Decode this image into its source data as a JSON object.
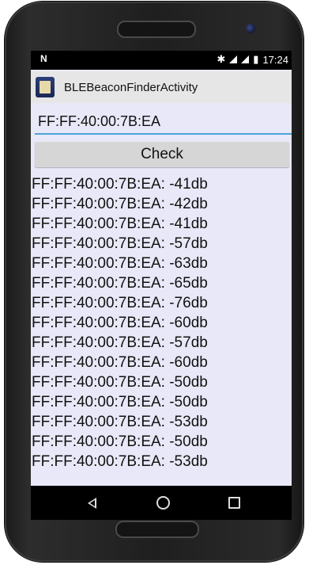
{
  "status_bar": {
    "left_icon": "N",
    "time": "17:24",
    "icons": [
      "bluetooth-icon",
      "wifi-icon",
      "signal-icon",
      "battery-icon"
    ]
  },
  "action_bar": {
    "title": "BLEBeaconFinderActivity",
    "app_icon": "app-icon"
  },
  "mac_input": {
    "value": "FF:FF:40:00:7B:EA"
  },
  "check_button": {
    "label": "Check"
  },
  "results": [
    "FF:FF:40:00:7B:EA: -41db",
    "FF:FF:40:00:7B:EA: -42db",
    "FF:FF:40:00:7B:EA: -41db",
    "FF:FF:40:00:7B:EA: -57db",
    "FF:FF:40:00:7B:EA: -63db",
    "FF:FF:40:00:7B:EA: -65db",
    "FF:FF:40:00:7B:EA: -76db",
    "FF:FF:40:00:7B:EA: -60db",
    "FF:FF:40:00:7B:EA: -57db",
    "FF:FF:40:00:7B:EA: -60db",
    "FF:FF:40:00:7B:EA: -50db",
    "FF:FF:40:00:7B:EA: -50db",
    "FF:FF:40:00:7B:EA: -53db",
    "FF:FF:40:00:7B:EA: -50db",
    "FF:FF:40:00:7B:EA: -53db"
  ],
  "colors": {
    "screen_background": "#e8e8f8",
    "input_underline": "#4aa3d6",
    "action_bar": "#e6e6e6",
    "button": "#d6d6d6"
  }
}
